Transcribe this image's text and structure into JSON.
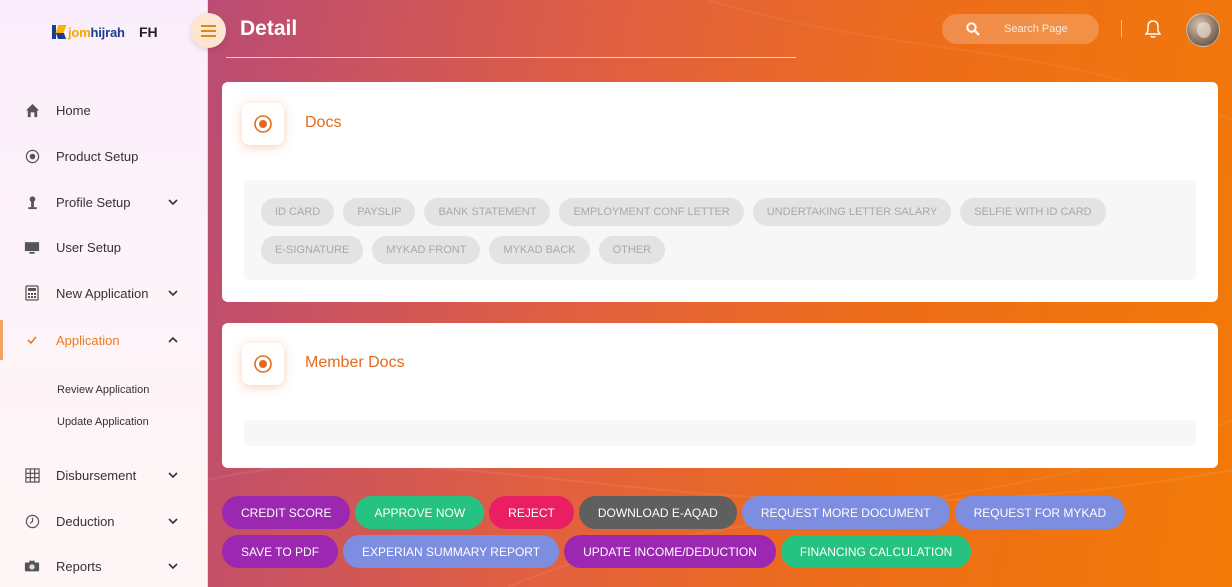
{
  "brand": {
    "name_part1": "jom",
    "name_part2": "hijrah",
    "abbr": "FH"
  },
  "header": {
    "title": "Detail",
    "search_placeholder": "Search Page"
  },
  "sidebar": {
    "items": [
      {
        "label": "Home",
        "icon": "home-icon"
      },
      {
        "label": "Product Setup",
        "icon": "target-icon"
      },
      {
        "label": "Profile Setup",
        "icon": "person-icon"
      },
      {
        "label": "User Setup",
        "icon": "monitor-icon"
      },
      {
        "label": "New Application",
        "icon": "calculator-icon"
      },
      {
        "label": "Application",
        "icon": "check-icon"
      },
      {
        "label": "Disbursement",
        "icon": "grid-icon"
      },
      {
        "label": "Deduction",
        "icon": "clock-icon"
      },
      {
        "label": "Reports",
        "icon": "camera-icon"
      }
    ],
    "sub_items": [
      "Review Application",
      "Update Application"
    ]
  },
  "docs": {
    "title": "Docs",
    "chips": [
      "ID CARD",
      "PAYSLIP",
      "BANK STATEMENT",
      "EMPLOYMENT CONF LETTER",
      "UNDERTAKING LETTER SALARY",
      "SELFIE WITH ID CARD",
      "E-SIGNATURE",
      "MYKAD FRONT",
      "MYKAD BACK",
      "OTHER"
    ]
  },
  "member_docs": {
    "title": "Member Docs"
  },
  "actions": [
    {
      "label": "CREDIT SCORE",
      "color": "#9c27b0"
    },
    {
      "label": "APPROVE NOW",
      "color": "#26c281"
    },
    {
      "label": "REJECT",
      "color": "#e91e63"
    },
    {
      "label": "DOWNLOAD E-AQAD",
      "color": "#5f5f5f"
    },
    {
      "label": "REQUEST MORE DOCUMENT",
      "color": "#7d8de0"
    },
    {
      "label": "REQUEST FOR MYKAD",
      "color": "#7d8de0"
    },
    {
      "label": "SAVE TO PDF",
      "color": "#9c27b0"
    },
    {
      "label": "EXPERIAN SUMMARY REPORT",
      "color": "#7d8de0"
    },
    {
      "label": "UPDATE INCOME/DEDUCTION",
      "color": "#9c27b0"
    },
    {
      "label": "FINANCING CALCULATION",
      "color": "#26c281"
    }
  ],
  "colors": {
    "accent": "#e46a1c",
    "sidebar_active": "#f07a1a"
  }
}
